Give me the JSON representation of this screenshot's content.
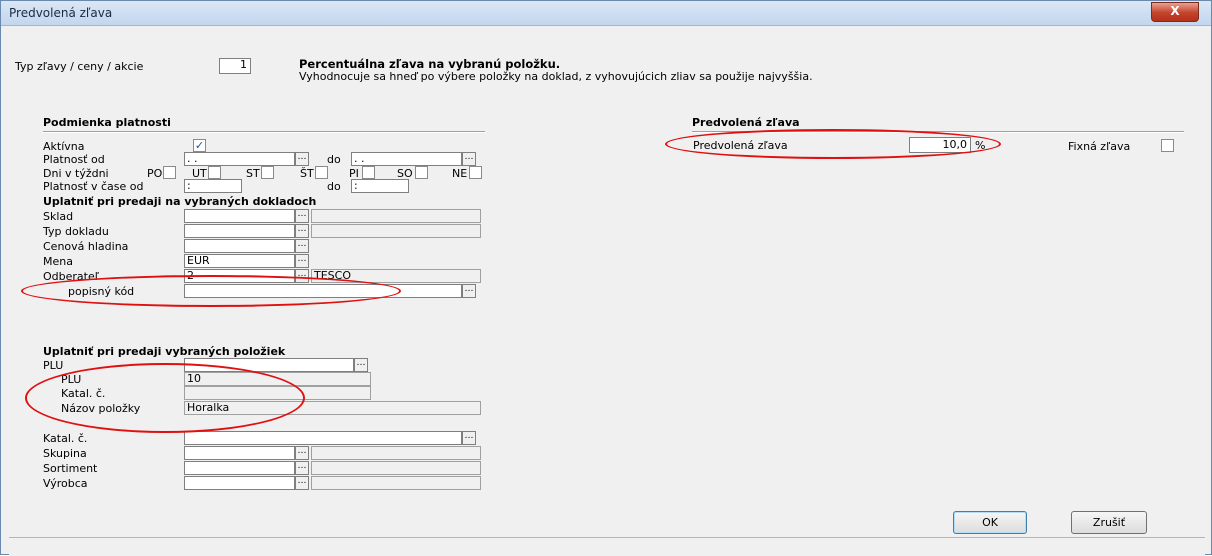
{
  "window": {
    "title": "Predvolená zľava",
    "close_label": "X"
  },
  "top": {
    "type_label": "Typ zľavy / ceny / akcie",
    "type_value": "1",
    "desc_title": "Percentuálna zľava na vybranú položku.",
    "desc_text": "Vyhodnocuje sa hneď po výbere položky na doklad, z vyhovujúcich zliav sa použije najvyššia."
  },
  "validity": {
    "header": "Podmienka platnosti",
    "active_label": "Aktívna",
    "active_checked": true,
    "valid_from_label": "Platnosť od",
    "valid_from_value": " . .",
    "to_label": "do",
    "valid_to_value": " . .",
    "days_label": "Dni v týždni",
    "days": [
      "PO",
      "UT",
      "ST",
      "ŠT",
      "PI",
      "SO",
      "NE"
    ],
    "time_label": "Platnosť v čase od",
    "time_from_value": " :",
    "time_to_label": "do",
    "time_to_value": " :"
  },
  "docs": {
    "header": "Uplatniť pri predaji na vybraných dokladoch",
    "rows": [
      {
        "label": "Sklad",
        "value": "",
        "extra": ""
      },
      {
        "label": "Typ dokladu",
        "value": "",
        "extra": ""
      },
      {
        "label": "Cenová hladina",
        "value": "",
        "extra": ""
      },
      {
        "label": "Mena",
        "value": "EUR",
        "extra": ""
      },
      {
        "label": "Odberateľ",
        "value": "2",
        "extra": "TESCO"
      }
    ],
    "code_label": "popisný kód",
    "code_value": ""
  },
  "items": {
    "header": "Uplatniť pri predaji vybraných položiek",
    "plu_label": "PLU",
    "plu_value": "",
    "sub_plu_label": "PLU",
    "sub_plu_value": "10",
    "sub_catal_label": "Katal. č.",
    "sub_catal_value": "",
    "sub_name_label": "Názov položky",
    "sub_name_value": "Horalka",
    "catal_label": "Katal. č.",
    "catal_value": "",
    "group_label": "Skupina",
    "assort_label": "Sortiment",
    "maker_label": "Výrobca"
  },
  "discount": {
    "header": "Predvolená zľava",
    "label": "Predvolená zľava",
    "value": "10,0",
    "unit": "%",
    "fixed_label": "Fixná zľava"
  },
  "buttons": {
    "ok": "OK",
    "cancel": "Zrušiť"
  },
  "colors": {
    "highlight": "#e01010",
    "title_bar": "#c3d6ee"
  }
}
